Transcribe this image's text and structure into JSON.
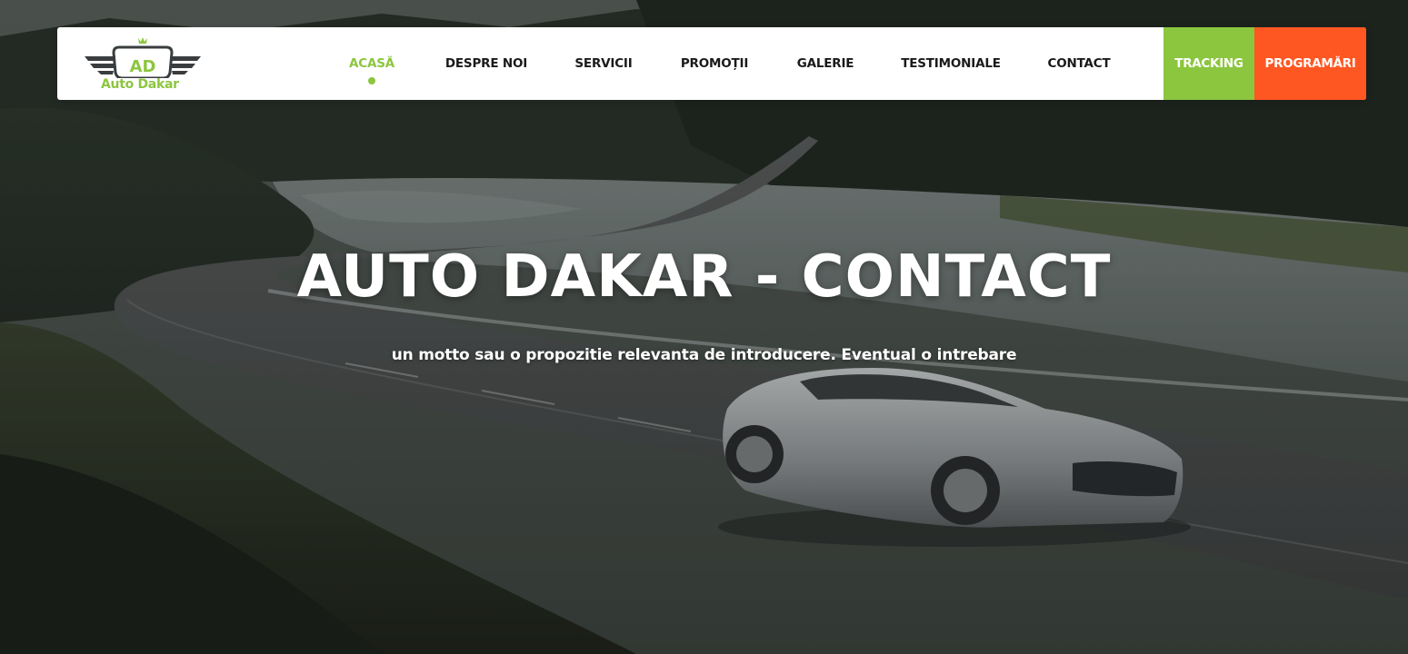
{
  "brand": {
    "logo_text": "Auto Dakar",
    "logo_monogram": "AD",
    "colors": {
      "green": "#8cc63f",
      "orange": "#ff5722",
      "nav_text": "#1a1a1a",
      "white": "#ffffff"
    }
  },
  "nav": {
    "items": [
      {
        "label": "ACASĂ",
        "active": true
      },
      {
        "label": "DESPRE NOI",
        "active": false
      },
      {
        "label": "SERVICII",
        "active": false
      },
      {
        "label": "PROMOȚII",
        "active": false
      },
      {
        "label": "GALERIE",
        "active": false
      },
      {
        "label": "TESTIMONIALE",
        "active": false
      },
      {
        "label": "CONTACT",
        "active": false
      }
    ],
    "tracking_label": "TRACKING",
    "programari_label": "PROGRAMĂRI"
  },
  "hero": {
    "title": "AUTO DAKAR - CONTACT",
    "subtitle": "un motto sau o propozitie relevanta de introducere. Eventual o intrebare",
    "background": "silver sports car on winding road by lake"
  }
}
